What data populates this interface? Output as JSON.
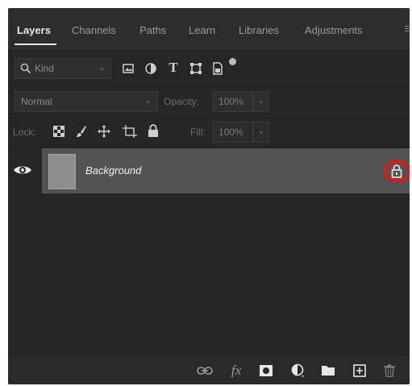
{
  "tabs": [
    {
      "label": "Layers"
    },
    {
      "label": "Channels"
    },
    {
      "label": "Paths"
    },
    {
      "label": "Learn"
    },
    {
      "label": "Libraries"
    },
    {
      "label": "Adjustments"
    }
  ],
  "filter": {
    "value": "Kind"
  },
  "blend": {
    "mode": "Normal",
    "opacity_label": "Opacity:",
    "opacity_value": "100%"
  },
  "lock": {
    "label": "Lock:",
    "fill_label": "Fill:",
    "fill_value": "100%"
  },
  "layer": {
    "name": "Background",
    "locked": true
  },
  "icons": {
    "filter": [
      "image-filter-icon",
      "adjustment-filter-icon",
      "type-filter-icon",
      "shape-filter-icon",
      "smart-object-filter-icon",
      "filter-toggle-icon"
    ],
    "lock": [
      "lock-transparent-pixels-icon",
      "lock-image-pixels-icon",
      "lock-position-icon",
      "lock-artboard-icon",
      "lock-all-icon"
    ],
    "bottom": [
      "link-layers-icon",
      "fx-icon",
      "layer-mask-icon",
      "adjustment-layer-icon",
      "group-icon",
      "new-layer-icon",
      "delete-layer-icon"
    ]
  },
  "colors": {
    "panel": "#262626",
    "selected_row": "#535353",
    "highlight_ring": "#e01616"
  }
}
